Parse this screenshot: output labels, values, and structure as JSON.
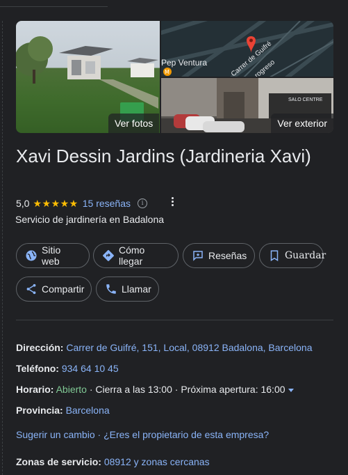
{
  "photos": {
    "main_label": "Ver fotos",
    "street_label": "Ver exterior",
    "map_labels": {
      "poi": "Pep Ventura",
      "street": "Carrer de Guifré",
      "street2": "rogreso"
    },
    "street_sign": "SALO CENTRE"
  },
  "business": {
    "name": "Xavi Dessin Jardins (Jardineria Xavi)",
    "rating": "5,0",
    "stars": "★★★★★",
    "reviews_link": "15 reseñas",
    "category": "Servicio de jardinería en Badalona"
  },
  "actions": {
    "website": "Sitio web",
    "directions": "Cómo llegar",
    "reviews": "Reseñas",
    "save": "Guardar",
    "share": "Compartir",
    "call": "Llamar"
  },
  "details": {
    "address_label": "Dirección:",
    "address_value": "Carrer de Guifré, 151, Local, 08912 Badalona, Barcelona",
    "phone_label": "Teléfono:",
    "phone_value": "934 64 10 45",
    "hours_label": "Horario:",
    "hours_status": "Abierto",
    "hours_close": " · Cierra a las 13:00 · Próxima apertura: 16:00",
    "province_label": "Provincia:",
    "province_value": "Barcelona",
    "suggest_edit": "Sugerir un cambio",
    "separator": " · ",
    "owner_link": "¿Eres el propietario de esta empresa?",
    "service_area_label": "Zonas de servicio:",
    "service_area_value": "08912 y zonas cercanas"
  },
  "colors": {
    "background": "#202124",
    "link": "#8ab4f8",
    "open": "#81c995",
    "star": "#fbbc04",
    "pin": "#ea4335"
  }
}
